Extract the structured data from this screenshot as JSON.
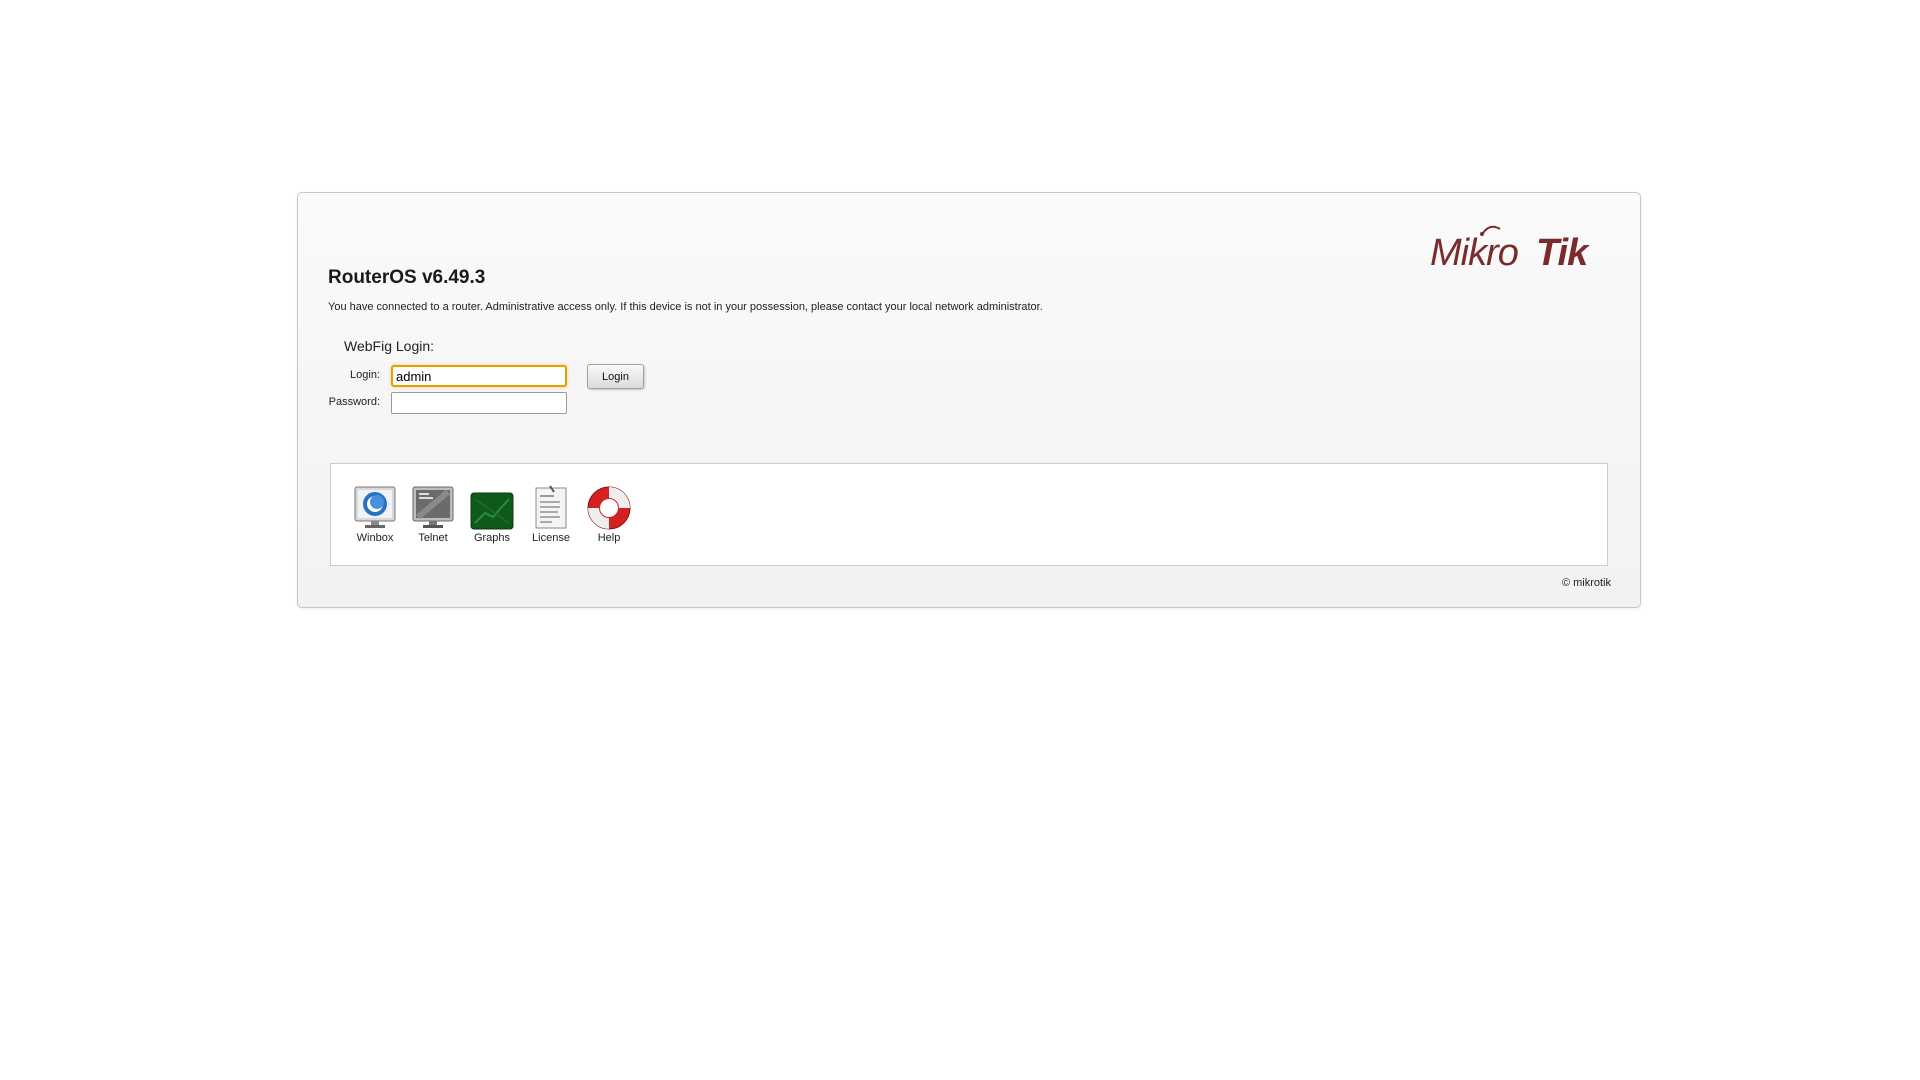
{
  "header": {
    "logo_text": "MikroTik",
    "title": "RouterOS v6.49.3",
    "notice": "You have connected to a router. Administrative access only. If this device is not in your possession, please contact your local network administrator."
  },
  "login_form": {
    "heading": "WebFig Login:",
    "login_label": "Login:",
    "login_value": "admin",
    "password_label": "Password:",
    "password_value": "",
    "submit_label": "Login"
  },
  "tools": [
    {
      "label": "Winbox",
      "icon": "winbox-icon"
    },
    {
      "label": "Telnet",
      "icon": "telnet-icon"
    },
    {
      "label": "Graphs",
      "icon": "graphs-icon"
    },
    {
      "label": "License",
      "icon": "license-icon"
    },
    {
      "label": "Help",
      "icon": "help-icon"
    }
  ],
  "footer": {
    "copyright": "© mikrotik"
  },
  "colors": {
    "brand": "#7a2b2b",
    "focus_border": "#e8a000",
    "graphs_green": "#0f5a1a",
    "help_red": "#d42020"
  }
}
